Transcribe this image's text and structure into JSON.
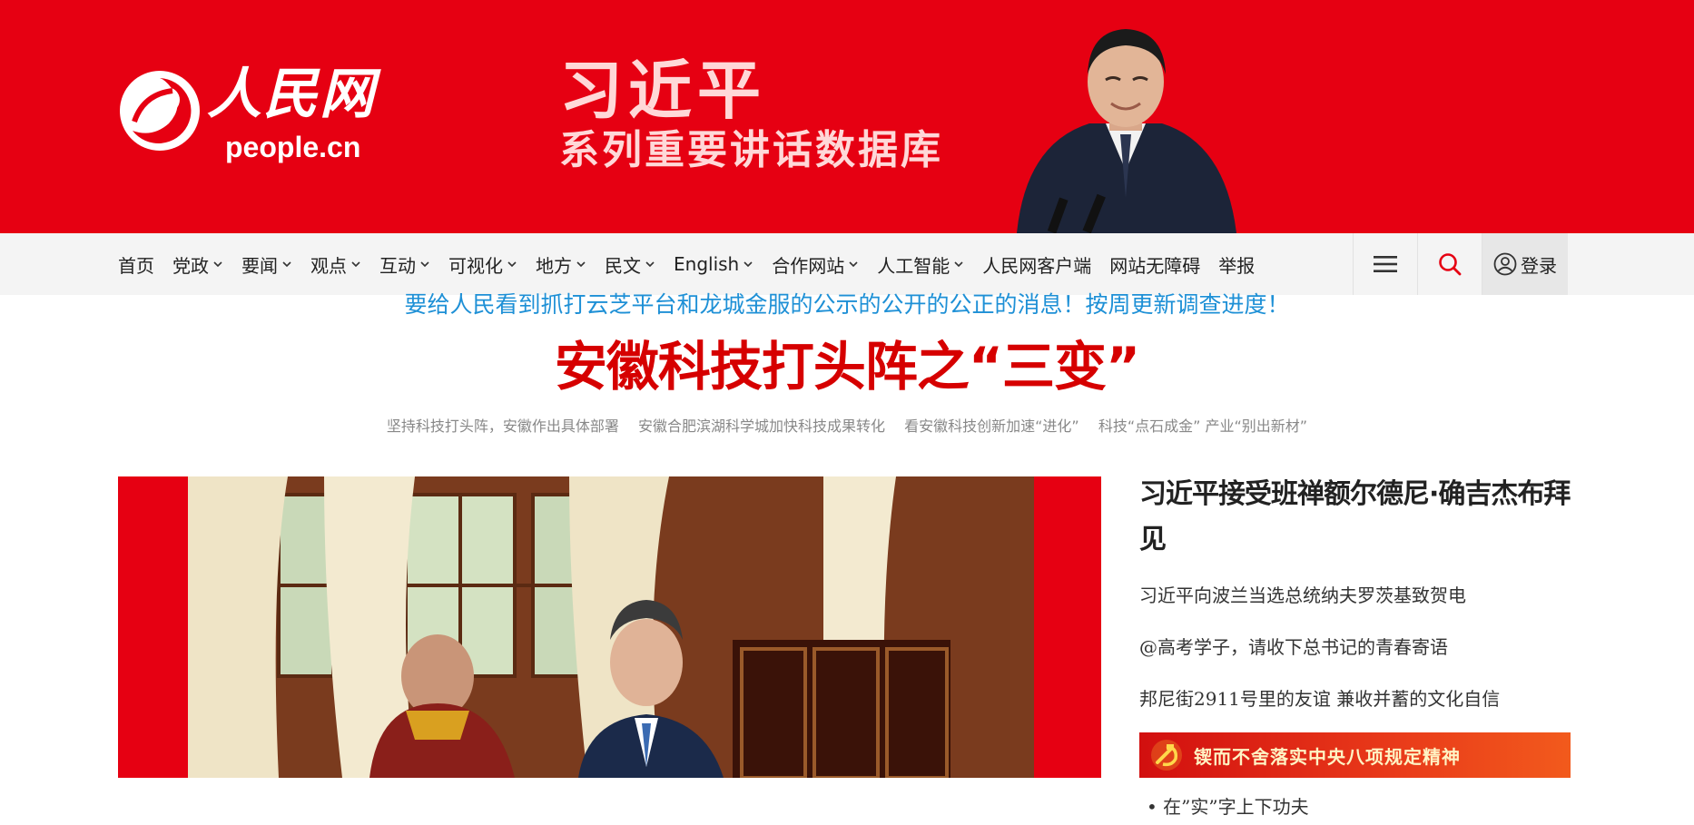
{
  "banner": {
    "logo_cn": "人民网",
    "logo_en": "people.cn",
    "promo_title": "习近平",
    "promo_subtitle": "系列重要讲话数据库"
  },
  "nav": {
    "items": [
      {
        "label": "首页",
        "dropdown": false
      },
      {
        "label": "党政",
        "dropdown": true
      },
      {
        "label": "要闻",
        "dropdown": true
      },
      {
        "label": "观点",
        "dropdown": true
      },
      {
        "label": "互动",
        "dropdown": true
      },
      {
        "label": "可视化",
        "dropdown": true
      },
      {
        "label": "地方",
        "dropdown": true
      },
      {
        "label": "民文",
        "dropdown": true
      },
      {
        "label": "English",
        "dropdown": true
      },
      {
        "label": "合作网站",
        "dropdown": true
      },
      {
        "label": "人工智能",
        "dropdown": true
      },
      {
        "label": "人民网客户端",
        "dropdown": false
      },
      {
        "label": "网站无障碍",
        "dropdown": false
      },
      {
        "label": "举报",
        "dropdown": false
      }
    ],
    "menu_icon": "hamburger-icon",
    "search_icon": "search-icon",
    "login_label": "登录",
    "accent": "#e60012"
  },
  "notice": "要给人民看到抓打云芝平台和龙城金服的公示的公开的公正的消息！按周更新调查进度！",
  "headline": "安徽科技打头阵之“三变”",
  "subheads": [
    "坚持科技打头阵，安徽作出具体部署",
    "安徽合肥滨湖科学城加快科技成果转化",
    "看安徽科技创新加速“进化”",
    "科技“点石成金” 产业“别出新材”"
  ],
  "side": {
    "top_story": "习近平接受班禅额尔德尼·确吉杰布拜见",
    "links": [
      "习近平向波兰当选总统纳夫罗茨基致贺电",
      "@高考学子，请收下总书记的青春寄语",
      "邦尼街2911号里的友谊  兼收并蓄的文化自信"
    ],
    "banner_text": "锲而不舍落实中央八项规定精神",
    "bullet": "• 在”实”字上下功夫"
  }
}
